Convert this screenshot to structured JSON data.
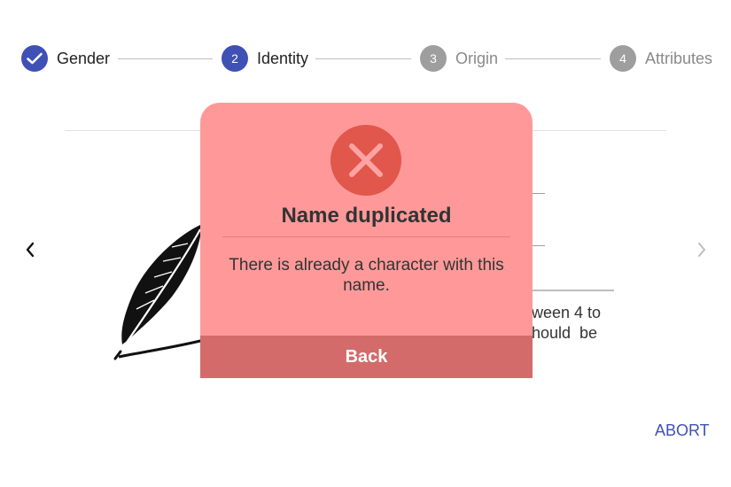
{
  "stepper": {
    "steps": [
      {
        "number": "",
        "label": "Gender",
        "state": "done",
        "icon": "check-icon"
      },
      {
        "number": "2",
        "label": "Identity",
        "state": "active"
      },
      {
        "number": "3",
        "label": "Origin",
        "state": "pending"
      },
      {
        "number": "4",
        "label": "Attributes",
        "state": "pending"
      }
    ]
  },
  "background": {
    "prev_icon": "chevron-left-icon",
    "next_icon": "chevron-right-icon",
    "illustration_icon": "feather-quill-icon",
    "hint_line1": "ween 4 to",
    "hint_line2": "hould  be"
  },
  "abort_label": "ABORT",
  "modal": {
    "icon": "error-x-icon",
    "title": "Name duplicated",
    "message": "There is already a character with this name.",
    "button_label": "Back"
  },
  "colors": {
    "accent": "#3f51b5",
    "pending": "#9e9e9e",
    "modal_bg": "#ff9999",
    "modal_icon": "#e1574c",
    "modal_button": "#d36b6b"
  }
}
